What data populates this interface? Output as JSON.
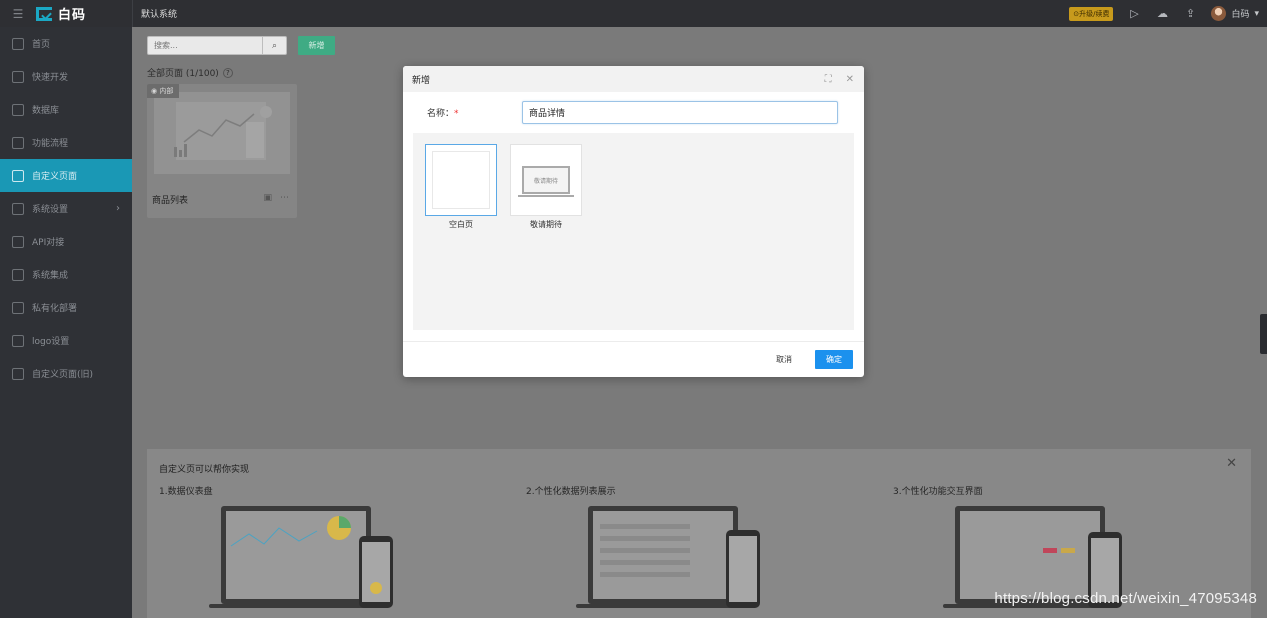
{
  "topbar": {
    "logo_text": "白码",
    "system_name": "默认系统",
    "upgrade_label": "⊙升级/续费",
    "username": "白码"
  },
  "sidebar": {
    "items": [
      {
        "label": "首页",
        "icon": "home-icon"
      },
      {
        "label": "快速开发",
        "icon": "dev-icon"
      },
      {
        "label": "数据库",
        "icon": "database-icon"
      },
      {
        "label": "功能流程",
        "icon": "flow-icon"
      },
      {
        "label": "自定义页面",
        "icon": "page-icon"
      },
      {
        "label": "系统设置",
        "icon": "settings-icon"
      },
      {
        "label": "API对接",
        "icon": "api-icon"
      },
      {
        "label": "系统集成",
        "icon": "integration-icon"
      },
      {
        "label": "私有化部署",
        "icon": "deploy-icon"
      },
      {
        "label": "logo设置",
        "icon": "logo-icon"
      },
      {
        "label": "自定义页面(旧)",
        "icon": "page-old-icon"
      }
    ],
    "active": "自定义页面"
  },
  "main": {
    "search_placeholder": "搜索...",
    "add_label": "新增",
    "all_pages_label": "全部页面 (1/100)",
    "card": {
      "tag": "内部",
      "name": "商品列表"
    },
    "promo": {
      "title": "自定义页可以帮你实现",
      "items": [
        "1.数据仪表盘",
        "2.个性化数据列表展示",
        "3.个性化功能交互界面"
      ]
    }
  },
  "modal": {
    "title": "新增",
    "name_label": "名称：",
    "required_mark": "*",
    "name_value": "商品详情",
    "templates": [
      {
        "label": "空白页",
        "selected": true
      },
      {
        "label": "敬请期待",
        "inner_text": "敬请期待",
        "selected": false
      }
    ],
    "cancel_label": "取消",
    "ok_label": "确定"
  },
  "watermark": "https://blog.csdn.net/weixin_47095348",
  "colors": {
    "accent": "#1a98b5",
    "primary_button": "#1b91ee",
    "add_button": "#3fab84",
    "topbar": "#2e2f33",
    "sidebar": "#2f3136"
  }
}
